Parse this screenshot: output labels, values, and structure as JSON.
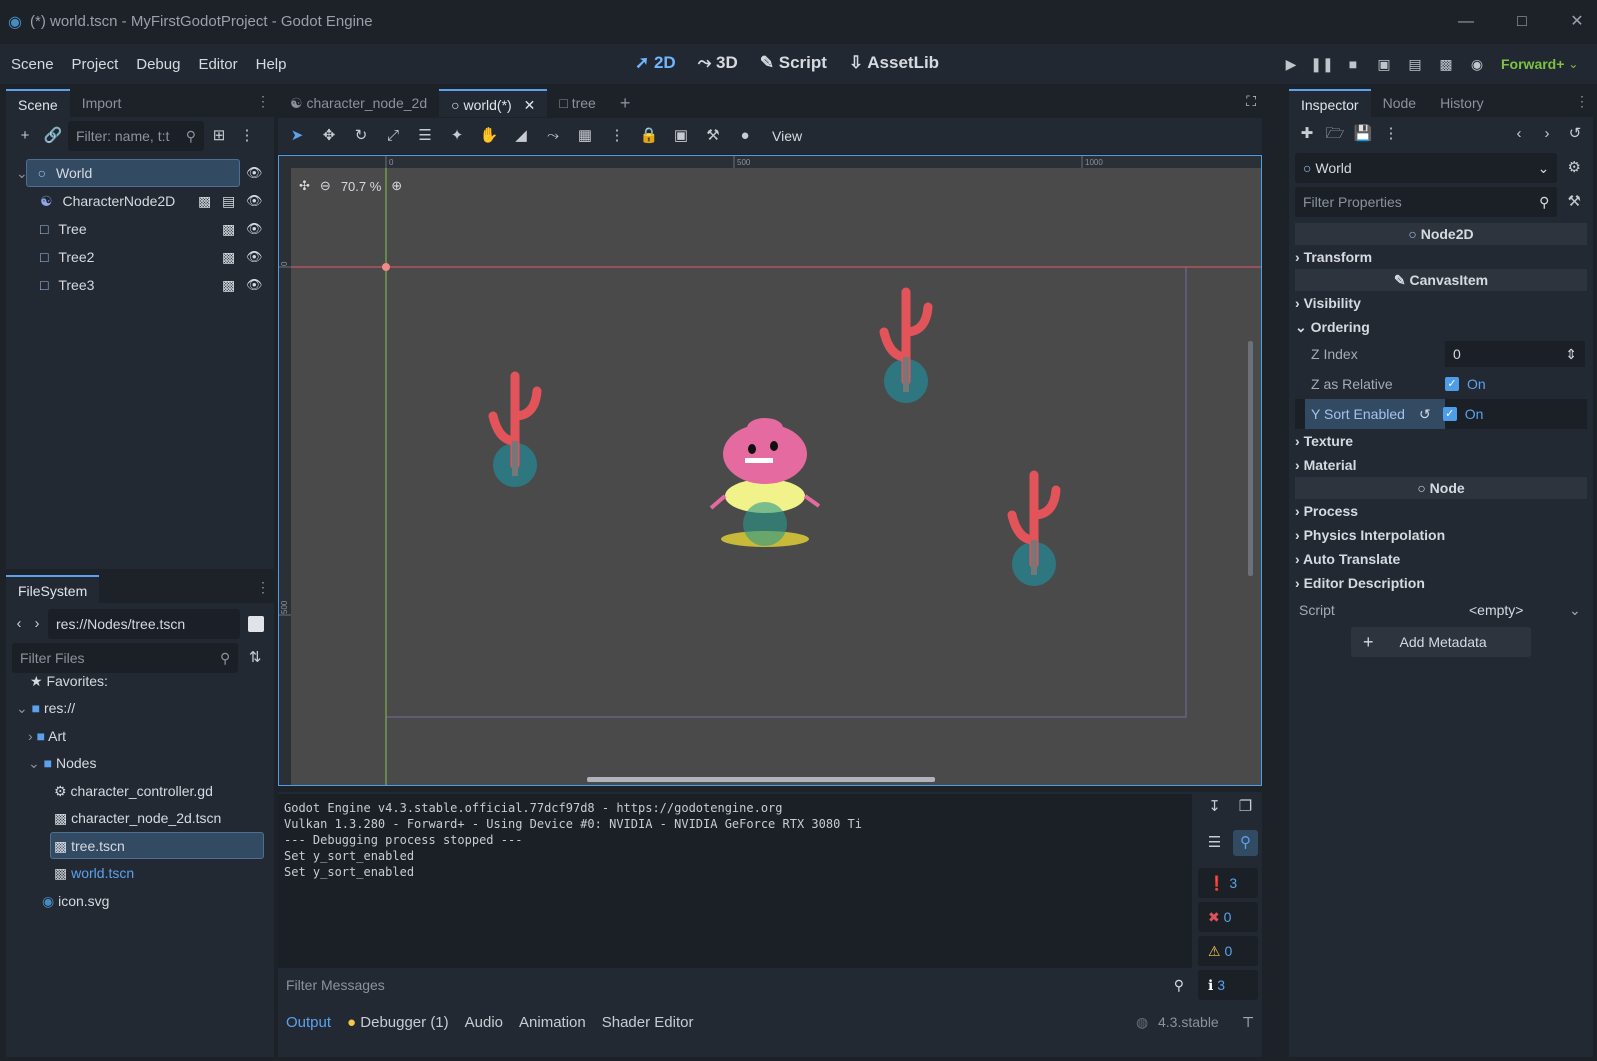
{
  "window": {
    "title": "(*) world.tscn - MyFirstGodotProject - Godot Engine"
  },
  "menu": [
    "Scene",
    "Project",
    "Debug",
    "Editor",
    "Help"
  ],
  "modes": {
    "m2d": "2D",
    "m3d": "3D",
    "script": "Script",
    "assetlib": "AssetLib"
  },
  "renderer": "Forward+",
  "scene_panel": {
    "tab_scene": "Scene",
    "tab_import": "Import",
    "filter_placeholder": "Filter: name, t:t",
    "nodes": [
      "World",
      "CharacterNode2D",
      "Tree",
      "Tree2",
      "Tree3"
    ]
  },
  "filesystem": {
    "tab": "FileSystem",
    "path": "res://Nodes/tree.tscn",
    "filter_placeholder": "Filter Files",
    "items": [
      "Favorites:",
      "res://",
      "Art",
      "Nodes",
      "character_controller.gd",
      "character_node_2d.tscn",
      "tree.tscn",
      "world.tscn",
      "icon.svg"
    ]
  },
  "editor_tabs": [
    "character_node_2d",
    "world(*)",
    "tree"
  ],
  "viewport": {
    "view_label": "View",
    "zoom": "70.7 %",
    "ruler_marks": [
      "0",
      "500",
      "1000"
    ],
    "ruler_v": [
      "0",
      "500"
    ]
  },
  "console": {
    "lines": [
      "Godot Engine v4.3.stable.official.77dcf97d8 - https://godotengine.org",
      "Vulkan 1.3.280 - Forward+ - Using Device #0: NVIDIA - NVIDIA GeForce RTX 3080 Ti",
      "",
      "--- Debugging process stopped ---",
      "Set y_sort_enabled",
      "Set y_sort_enabled"
    ],
    "filter_placeholder": "Filter Messages",
    "counts": {
      "messages": "3",
      "errors": "0",
      "warnings": "0",
      "editor": "3"
    }
  },
  "bottom_tabs": {
    "output": "Output",
    "debugger": "Debugger (1)",
    "audio": "Audio",
    "animation": "Animation",
    "shader": "Shader Editor"
  },
  "version": "4.3.stable",
  "inspector": {
    "tabs": [
      "Inspector",
      "Node",
      "History"
    ],
    "object": "World",
    "filter_placeholder": "Filter Properties",
    "node2d": "Node2D",
    "transform": "Transform",
    "canvasitem": "CanvasItem",
    "visibility": "Visibility",
    "ordering": "Ordering",
    "z_index_label": "Z Index",
    "z_index_value": "0",
    "z_relative_label": "Z as Relative",
    "z_relative_value": "On",
    "y_sort_label": "Y Sort Enabled",
    "y_sort_value": "On",
    "texture": "Texture",
    "material": "Material",
    "node": "Node",
    "process": "Process",
    "physics_interp": "Physics Interpolation",
    "auto_translate": "Auto Translate",
    "editor_desc": "Editor Description",
    "script_label": "Script",
    "script_value": "<empty>",
    "add_metadata": "Add Metadata"
  }
}
